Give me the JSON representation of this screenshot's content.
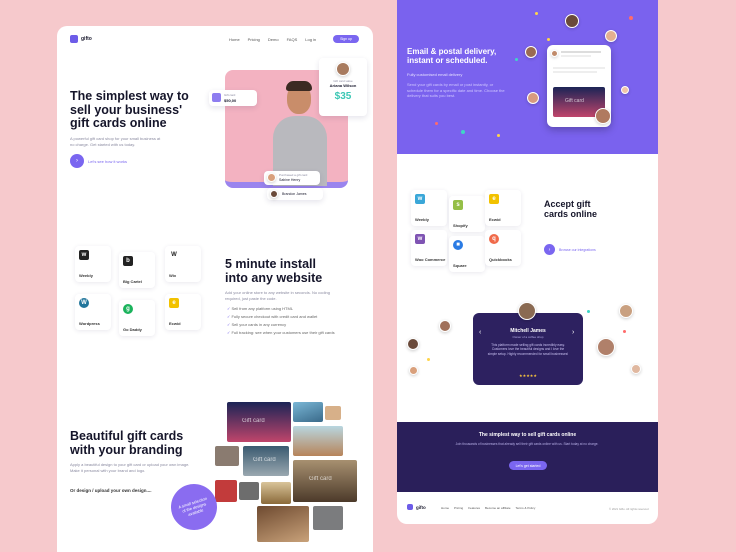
{
  "brand": {
    "name": "gifto",
    "accent": "#7a66f0",
    "dark": "#2a1f5a",
    "purple_bg": "#7a62ee"
  },
  "nav": {
    "items": [
      "Home",
      "Pricing",
      "Demo",
      "FAQS",
      "Log in"
    ],
    "cta": "Sign up"
  },
  "hero": {
    "title_line1": "The simplest way to",
    "title_line2": "sell your business'",
    "title_line3": "gift cards online",
    "subtitle": "A powerful gift card shop for your small business at no charge. Get started with us today.",
    "cta": "Let's see how it works",
    "price_label": "Gift card",
    "price_value": "$50,00",
    "profile_name": "Ariana Wilson",
    "profile_label": "Gift card value",
    "amount": "$35",
    "user1_name": "Sabine Henry",
    "user1_label": "Purchased a gift card",
    "user2_name": "Brandon James"
  },
  "install": {
    "title_line1": "5 minute install",
    "title_line2": "into any website",
    "subtitle": "Add your online store to any website in seconds. No coding required, just paste the code.",
    "bullets": [
      "Sell from any platform using HTML",
      "Fully secure checkout with credit card and wallet",
      "Sell your cards in any currency",
      "Full tracking: see when your customers use their gift cards"
    ],
    "platforms": [
      "Weebly",
      "Big Cartel",
      "Wix",
      "Wordpress",
      "Go Daddy",
      "Ecwid"
    ]
  },
  "branding": {
    "title_line1": "Beautiful gift cards",
    "title_line2": "with your branding",
    "subtitle": "Apply a beautiful design to your gift card or upload your own image. Make it personal with your brand and logo.",
    "cta": "Or design / upload your own design....",
    "badge": "A small selection of the designs available"
  },
  "delivery": {
    "title_line1": "Email & postal delivery,",
    "title_line2": "instant or scheduled.",
    "subtitle": "Fully customised email delivery",
    "text": "Send your gift cards by email or post instantly, or schedule them for a specific date and time. Choose the delivery that suits you best."
  },
  "accept": {
    "title_line1": "Accept gift",
    "title_line2": "cards online",
    "cta": "Browse our integrations",
    "platforms": [
      "Weebly",
      "Shopify",
      "Ecwid",
      "Woo Commerce",
      "Square",
      "Quickbooks"
    ]
  },
  "testimonial": {
    "name": "Mitchell James",
    "role": "Owner of a coffee shop",
    "text": "This platform made selling gift cards incredibly easy. Customers love the beautiful designs and I love the simple setup. Highly recommended for small businesses!",
    "stars": "★★★★★",
    "prev": "‹",
    "next": "›"
  },
  "footer_band": {
    "title": "The simplest way to sell gift cards online",
    "text": "Join thousands of businesses that already sell their gift cards online with us. Start today at no charge.",
    "cta": "Let's get started"
  },
  "footer": {
    "brand": "gifto",
    "links": [
      "Home",
      "Pricing",
      "Features",
      "Become an affiliate",
      "Terms & Policy"
    ],
    "copyright": "© 2021 Gifto. All rights reserved"
  },
  "giftcard_label": "Gift card"
}
